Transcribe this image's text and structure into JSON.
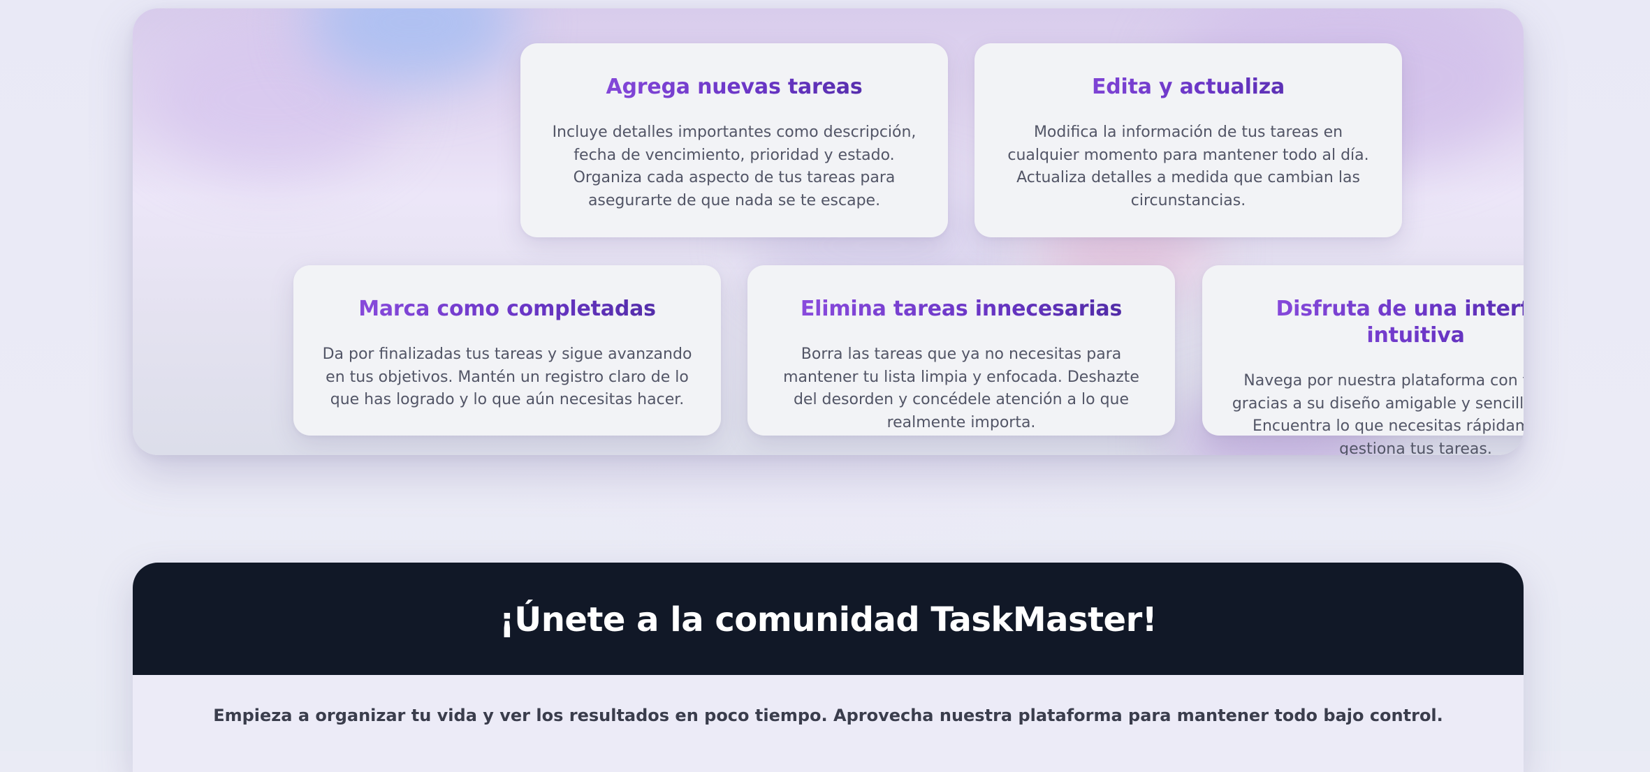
{
  "features": {
    "cards": [
      {
        "title": "Agrega nuevas tareas",
        "text": "Incluye detalles importantes como descripción, fecha de vencimiento, prioridad y estado. Organiza cada aspecto de tus tareas para asegurarte de que nada se te escape."
      },
      {
        "title": "Edita y actualiza",
        "text": "Modifica la información de tus tareas en cualquier momento para mantener todo al día. Actualiza detalles a medida que cambian las circunstancias."
      },
      {
        "title": "Marca como completadas",
        "text": "Da por finalizadas tus tareas y sigue avanzando en tus objetivos. Mantén un registro claro de lo que has logrado y lo que aún necesitas hacer."
      },
      {
        "title": "Elimina tareas innecesarias",
        "text": "Borra las tareas que ya no necesitas para mantener tu lista limpia y enfocada. Deshazte del desorden y concédele atención a lo que realmente importa."
      },
      {
        "title": "Disfruta de una interfaz intuitiva",
        "text": "Navega por nuestra plataforma con facilidad gracias a su diseño amigable y sencillo de usar. Encuentra lo que necesitas rápidamente y gestiona tus tareas."
      }
    ]
  },
  "community": {
    "title": "¡Únete a la comunidad TaskMaster!",
    "text": "Empieza a organizar tu vida y ver los resultados en poco tiempo. Aprovecha nuestra plataforma para mantener todo bajo control."
  },
  "colors": {
    "page_background": "#eaebf5",
    "card_background": "#f2f3f6",
    "card_title_gradient_start": "#8e4ee0",
    "card_title_gradient_end": "#4c2aa0",
    "card_text": "#525566",
    "community_header": "#111827",
    "community_body": "#ecebf7"
  }
}
